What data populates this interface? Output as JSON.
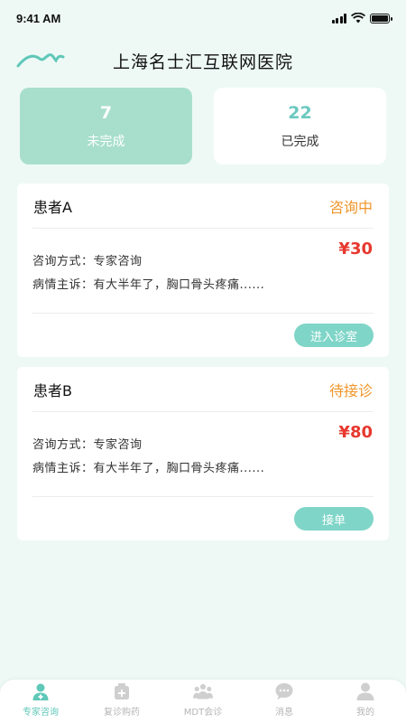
{
  "status_bar": {
    "time": "9:41 AM"
  },
  "header": {
    "title": "上海名士汇互联网医院"
  },
  "stats": {
    "pending": {
      "count": "7",
      "label": "未完成"
    },
    "completed": {
      "count": "22",
      "label": "已完成"
    }
  },
  "orders": [
    {
      "patient": "患者A",
      "status": "咨询中",
      "price": "¥30",
      "method": "咨询方式：专家咨询",
      "complaint": "病情主诉：有大半年了，胸口骨头疼痛......",
      "action": "进入诊室"
    },
    {
      "patient": "患者B",
      "status": "待接诊",
      "price": "¥80",
      "method": "咨询方式：专家咨询",
      "complaint": "病情主诉：有大半年了，胸口骨头疼痛......",
      "action": "接单"
    }
  ],
  "tabs": [
    {
      "label": "专家咨询",
      "icon": "doctor-icon",
      "active": true
    },
    {
      "label": "复诊购药",
      "icon": "medicine-kit-icon",
      "active": false
    },
    {
      "label": "MDT会诊",
      "icon": "group-icon",
      "active": false
    },
    {
      "label": "消息",
      "icon": "chat-bubble-icon",
      "active": false
    },
    {
      "label": "我的",
      "icon": "user-icon",
      "active": false
    }
  ],
  "colors": {
    "accent": "#7fd5c8",
    "pending_card": "#a8dfcc",
    "status_orange": "#f0962a",
    "price_red": "#e8382e",
    "background": "#eef9f6"
  }
}
